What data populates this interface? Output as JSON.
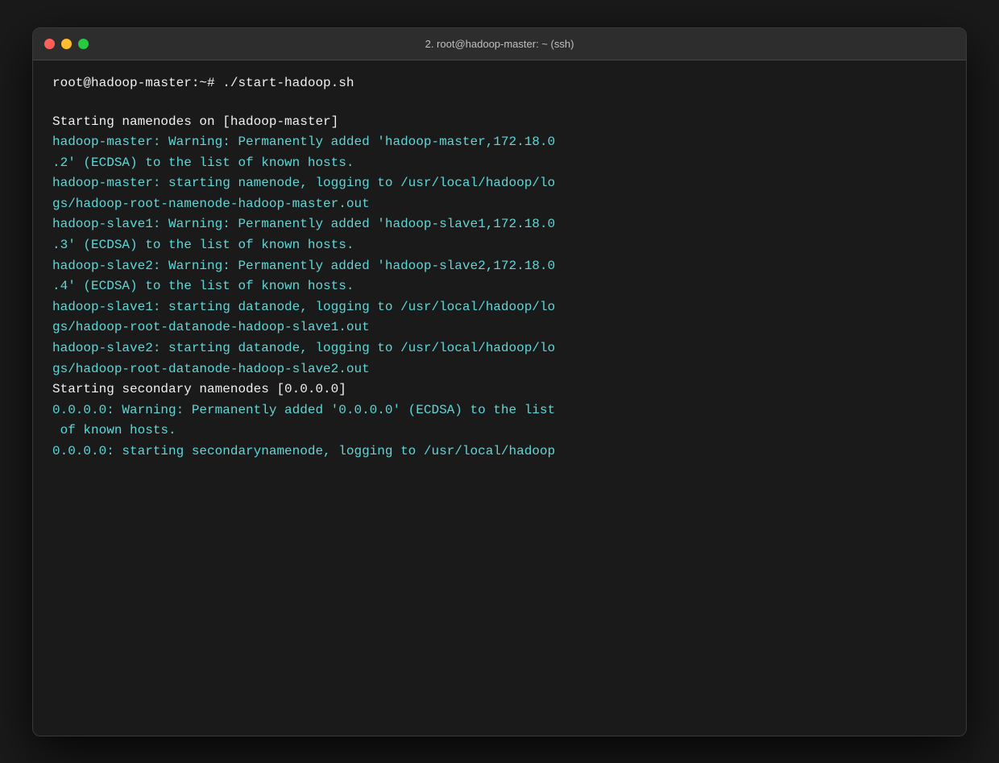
{
  "window": {
    "title": "2. root@hadoop-master: ~ (ssh)",
    "traffic_lights": {
      "close": "close",
      "minimize": "minimize",
      "maximize": "maximize"
    }
  },
  "terminal": {
    "prompt": "root@hadoop-master:~# ./start-hadoop.sh",
    "output_lines": [
      {
        "text": "Starting namenodes on [hadoop-master]",
        "color": "white"
      },
      {
        "text": "hadoop-master: Warning: Permanently added 'hadoop-master,172.18.0",
        "color": "cyan"
      },
      {
        "text": ".2' (ECDSA) to the list of known hosts.",
        "color": "cyan"
      },
      {
        "text": "hadoop-master: starting namenode, logging to /usr/local/hadoop/lo",
        "color": "cyan"
      },
      {
        "text": "gs/hadoop-root-namenode-hadoop-master.out",
        "color": "cyan"
      },
      {
        "text": "hadoop-slave1: Warning: Permanently added 'hadoop-slave1,172.18.0",
        "color": "cyan"
      },
      {
        "text": ".3' (ECDSA) to the list of known hosts.",
        "color": "cyan"
      },
      {
        "text": "hadoop-slave2: Warning: Permanently added 'hadoop-slave2,172.18.0",
        "color": "cyan"
      },
      {
        "text": ".4' (ECDSA) to the list of known hosts.",
        "color": "cyan"
      },
      {
        "text": "hadoop-slave1: starting datanode, logging to /usr/local/hadoop/lo",
        "color": "cyan"
      },
      {
        "text": "gs/hadoop-root-datanode-hadoop-slave1.out",
        "color": "cyan"
      },
      {
        "text": "hadoop-slave2: starting datanode, logging to /usr/local/hadoop/lo",
        "color": "cyan"
      },
      {
        "text": "gs/hadoop-root-datanode-hadoop-slave2.out",
        "color": "cyan"
      },
      {
        "text": "Starting secondary namenodes [0.0.0.0]",
        "color": "white"
      },
      {
        "text": "0.0.0.0: Warning: Permanently added '0.0.0.0' (ECDSA) to the list",
        "color": "cyan"
      },
      {
        "text": " of known hosts.",
        "color": "cyan"
      },
      {
        "text": "0.0.0.0: starting secondarynamenode, logging to /usr/local/hadoop",
        "color": "cyan"
      }
    ]
  }
}
